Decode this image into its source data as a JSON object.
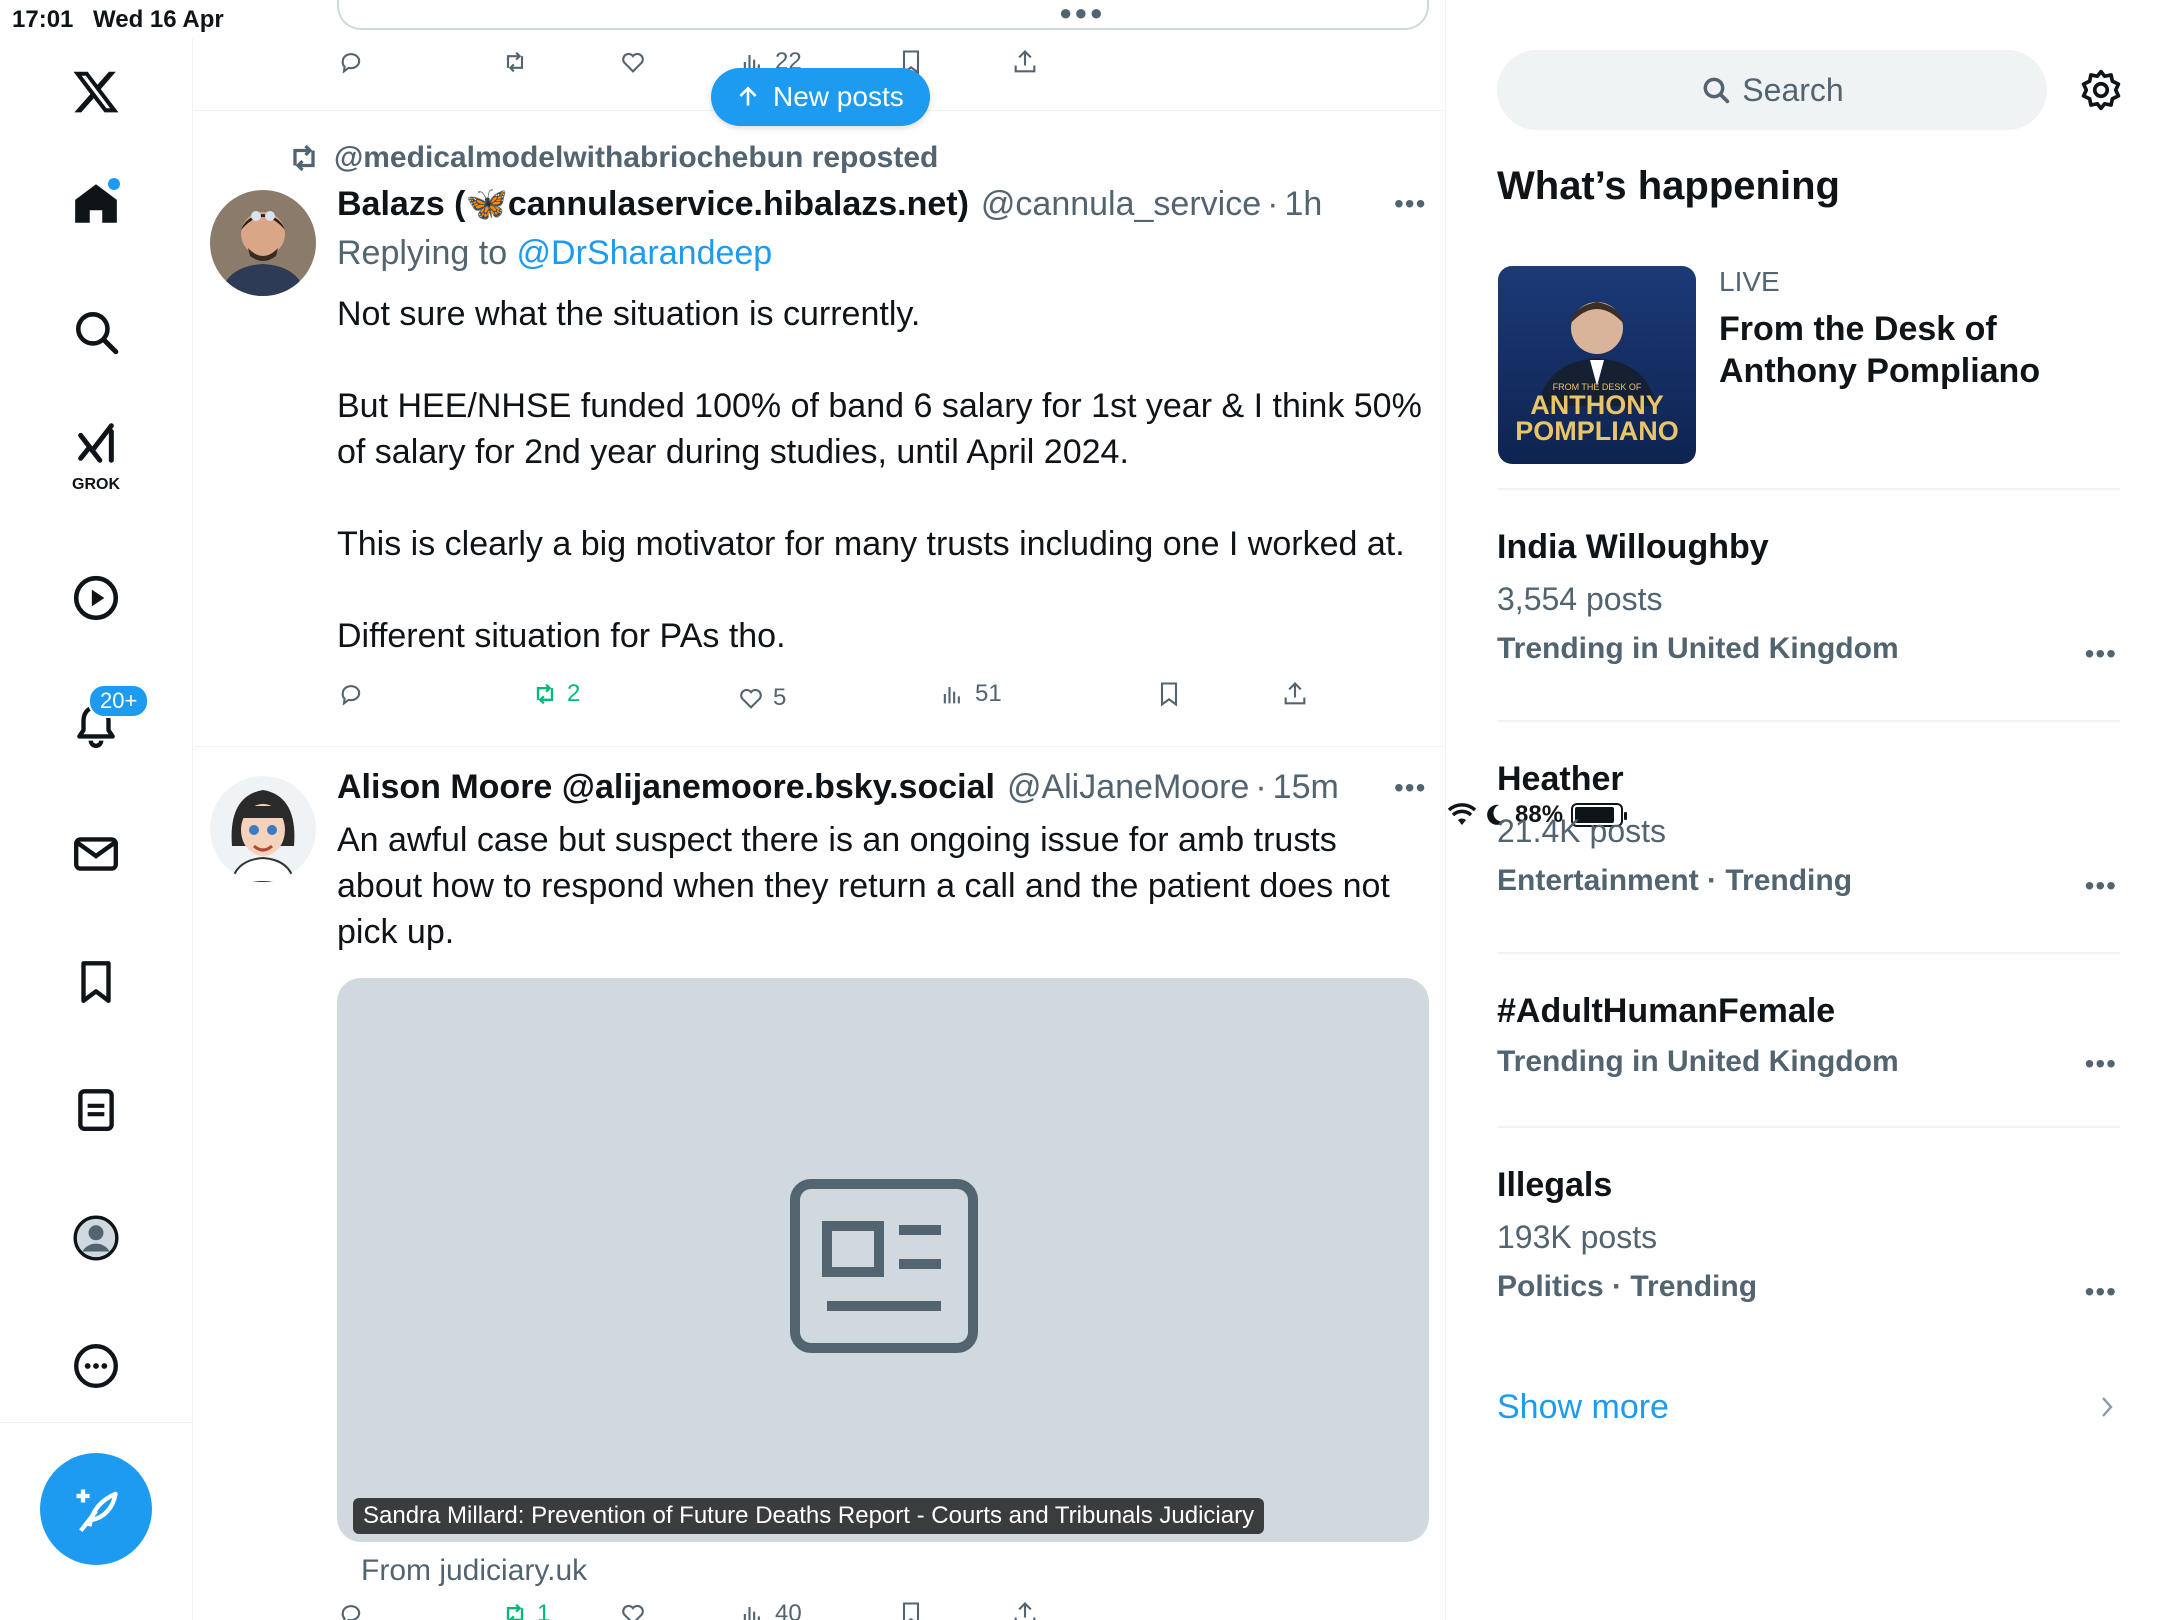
{
  "status_bar": {
    "time": "17:01",
    "date": "Wed 16 Apr",
    "battery": "88%",
    "battery_level": 0.88
  },
  "nav": {
    "grok_label": "GROK",
    "notifications_badge": "20+"
  },
  "feed": {
    "new_posts_label": "New posts",
    "top_post_actions": {
      "replies": "",
      "reposts": "",
      "likes": "",
      "views": "22"
    },
    "posts": [
      {
        "repost_by": "@medicalmodelwithabriochebun reposted",
        "name": "Balazs (🦋cannulaservice.hibalazs.net)",
        "handle": "@cannula_service",
        "sep": "·",
        "time": "1h",
        "replying_prefix": "Replying to ",
        "replying_to": "@DrSharandeep",
        "text": "Not sure what the situation is currently.\n\nBut HEE/NHSE funded 100% of band 6 salary for 1st year & I think 50% of salary for 2nd year during studies, until April 2024.\n\nThis is clearly a big motivator for many trusts including one I worked at.\n\nDifferent situation for PAs tho.",
        "reposts": "2",
        "likes": "5",
        "views": "51"
      },
      {
        "name": "Alison Moore @alijanemoore.bsky.social",
        "handle": "@AliJaneMoore",
        "sep": "·",
        "time": "15m",
        "text": "An awful case but suspect there is an ongoing issue for amb trusts about how to respond when they return a call and the patient does not pick up.",
        "card_caption": "Sandra Millard: Prevention of Future Deaths Report - Courts and Tribunals Judiciary",
        "card_source": "From judiciary.uk",
        "reposts": "1",
        "views": "40"
      }
    ]
  },
  "sidebar": {
    "search_placeholder": "Search",
    "heading": "What’s happening",
    "live": {
      "label": "LIVE",
      "title": "From the Desk of Anthony Pompliano",
      "thumb_small": "FROM THE DESK OF",
      "thumb_big_1": "ANTHONY",
      "thumb_big_2": "POMPLIANO"
    },
    "trends": [
      {
        "title": "India Willoughby",
        "count": "3,554 posts",
        "meta": "Trending in United Kingdom"
      },
      {
        "title": "Heather",
        "count": "21.4K posts",
        "meta": "Entertainment · Trending"
      },
      {
        "title": "#AdultHumanFemale",
        "count": "",
        "meta": "Trending in United Kingdom"
      },
      {
        "title": "Illegals",
        "count": "193K posts",
        "meta": "Politics · Trending"
      }
    ],
    "show_more": "Show more"
  },
  "colors": {
    "accent": "#1d9bf0",
    "repost_green": "#00ba7c",
    "muted": "#536471"
  }
}
